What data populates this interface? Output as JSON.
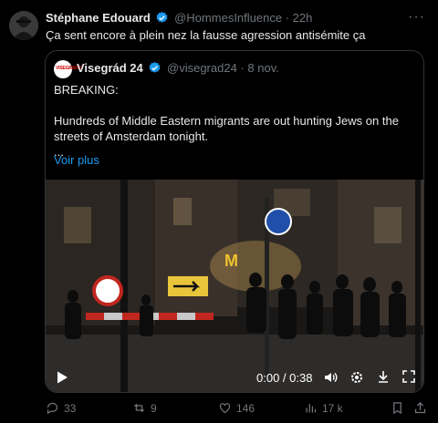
{
  "tweet": {
    "author_name": "Stéphane Edouard",
    "handle": "@HommesInfluence",
    "separator": "·",
    "time": "22h",
    "text": "Ça sent encore à plein nez la fausse agression antisémite ça"
  },
  "quote": {
    "author_name": "Visegrád 24",
    "handle": "@visegrad24",
    "separator": "·",
    "date": "8 nov.",
    "avatar_text": "VISEGRAD24",
    "line1": "BREAKING:",
    "line2": "Hundreds of Middle Eastern migrants are out hunting Jews on the",
    "line3": "streets of Amsterdam tonight.",
    "line4": "...",
    "see_more": "Voir plus"
  },
  "video": {
    "time_display": "0:00 / 0:38",
    "progress": 0
  },
  "actions": {
    "replies": "33",
    "reposts": "9",
    "likes": "146",
    "views": "17 k"
  },
  "colors": {
    "accent": "#1d9bf0",
    "muted": "#71767b",
    "text": "#e7e9ea",
    "border": "#2f3336"
  }
}
